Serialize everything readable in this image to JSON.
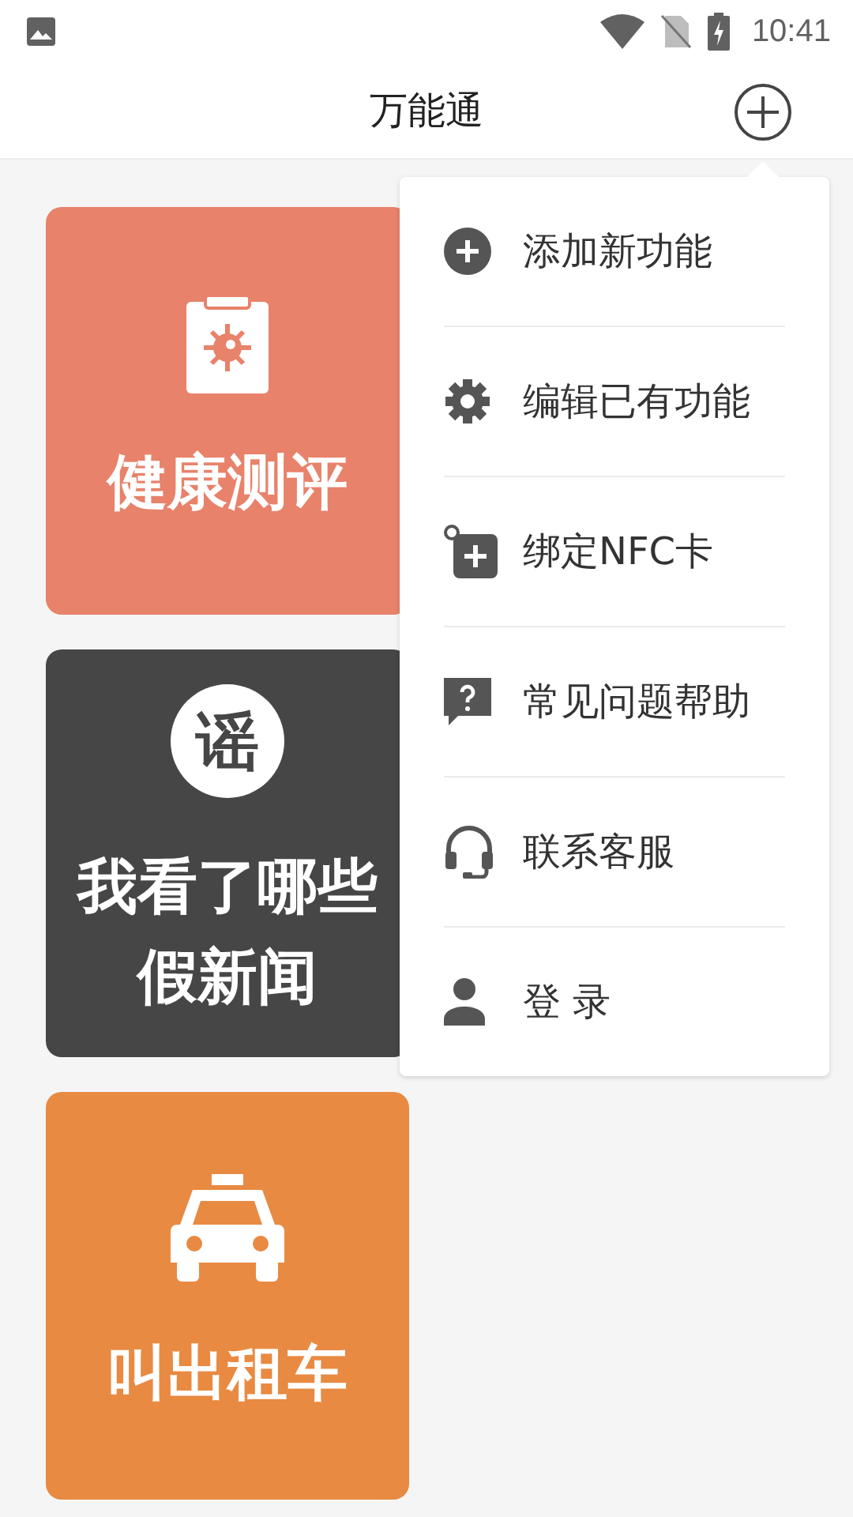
{
  "status_bar": {
    "time": "10:41"
  },
  "header": {
    "title": "万能通"
  },
  "cards": [
    {
      "kind": "clipboard",
      "title": "健康测评",
      "color": "#e8826a"
    },
    {
      "kind": "badge",
      "badge_text": "谣",
      "title": "我看了哪些假新闻",
      "color": "#464646"
    },
    {
      "kind": "taxi",
      "title": "叫出租车",
      "color": "#e88a42"
    }
  ],
  "menu": {
    "items": [
      {
        "kind": "add",
        "label": "添加新功能"
      },
      {
        "kind": "gear",
        "label": "编辑已有功能"
      },
      {
        "kind": "tag",
        "label": "绑定NFC卡"
      },
      {
        "kind": "help",
        "label": "常见问题帮助"
      },
      {
        "kind": "headset",
        "label": "联系客服"
      },
      {
        "kind": "person",
        "label": "登 录"
      }
    ]
  }
}
